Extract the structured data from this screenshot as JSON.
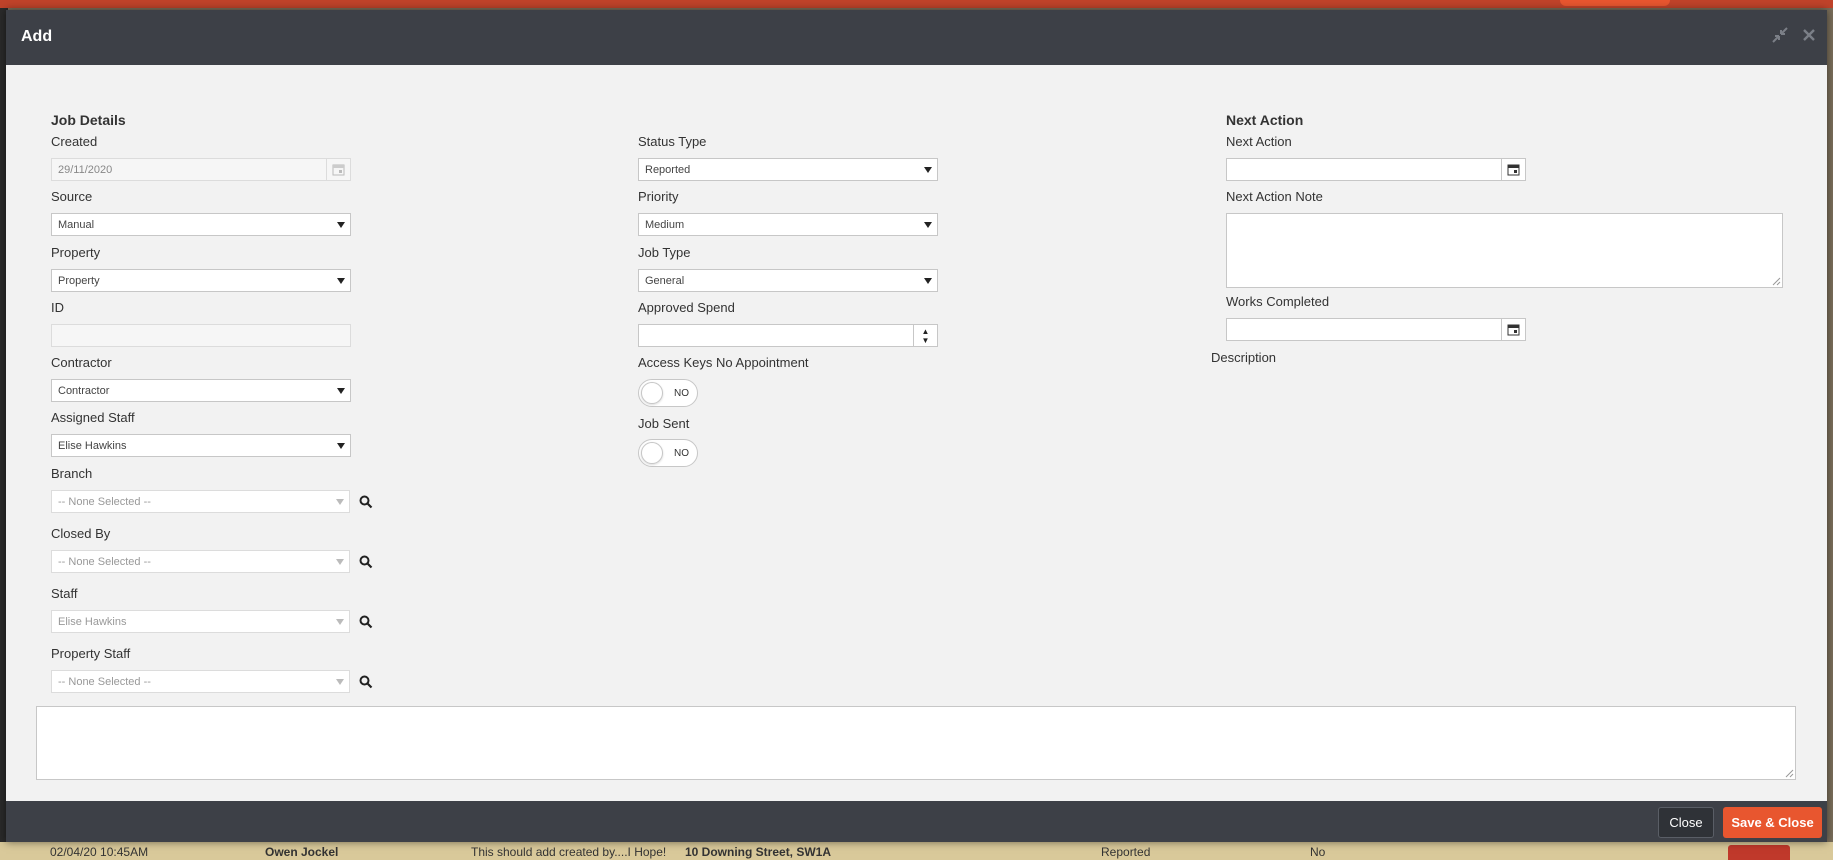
{
  "modal": {
    "title": "Add",
    "minimize_icon": "compress-icon",
    "close_icon": "close-icon"
  },
  "colors": {
    "header_bg": "#3d4047",
    "accent": "#e8562f",
    "body_bg": "#f2f2f2"
  },
  "left": {
    "section_title": "Job Details",
    "created": {
      "label": "Created",
      "value": "29/11/2020",
      "icon": "calendar-icon"
    },
    "source": {
      "label": "Source",
      "value": "Manual"
    },
    "property": {
      "label": "Property",
      "value": "Property"
    },
    "id": {
      "label": "ID",
      "value": ""
    },
    "contractor": {
      "label": "Contractor",
      "value": "Contractor"
    },
    "assigned_staff": {
      "label": "Assigned Staff",
      "value": "Elise Hawkins"
    },
    "branch": {
      "label": "Branch",
      "value": "-- None Selected --"
    },
    "closed_by": {
      "label": "Closed By",
      "value": "-- None Selected --"
    },
    "staff": {
      "label": "Staff",
      "value": "Elise Hawkins"
    },
    "property_staff": {
      "label": "Property Staff",
      "value": "-- None Selected --"
    }
  },
  "middle": {
    "status_type": {
      "label": "Status Type",
      "value": "Reported"
    },
    "priority": {
      "label": "Priority",
      "value": "Medium"
    },
    "job_type": {
      "label": "Job Type",
      "value": "General"
    },
    "approved_spend": {
      "label": "Approved Spend",
      "value": ""
    },
    "access_keys": {
      "label": "Access Keys No Appointment",
      "toggle": "NO"
    },
    "job_sent": {
      "label": "Job Sent",
      "toggle": "NO"
    }
  },
  "right": {
    "section_title": "Next Action",
    "next_action": {
      "label": "Next Action",
      "value": ""
    },
    "next_action_note": {
      "label": "Next Action Note",
      "value": ""
    },
    "works_completed": {
      "label": "Works Completed",
      "value": ""
    },
    "description": {
      "label": "Description",
      "value": ""
    }
  },
  "footer": {
    "close_label": "Close",
    "save_label": "Save & Close"
  },
  "background_row": {
    "date": "02/04/20 10:45AM",
    "name": "Owen Jockel",
    "note": "This should add created by....I Hope!",
    "address": "10 Downing Street, SW1A",
    "status": "Reported",
    "flag": "No"
  }
}
